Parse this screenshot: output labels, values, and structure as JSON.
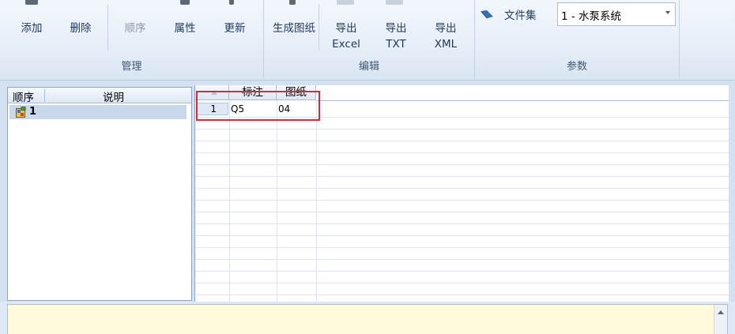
{
  "ribbon": {
    "groups": {
      "manage": "管理",
      "edit": "编辑",
      "params": "参数"
    },
    "buttons": {
      "add": "添加",
      "delete": "删除",
      "order": "顺序",
      "properties": "属性",
      "update": "更新",
      "generate": "生成图纸",
      "export_excel_1": "导出",
      "export_excel_2": "Excel",
      "export_txt_1": "导出",
      "export_txt_2": "TXT",
      "export_xml_1": "导出",
      "export_xml_2": "XML"
    },
    "fileset_label": "文件集",
    "fileset_value": "1 - 水泵系统"
  },
  "left_panel": {
    "headers": [
      "顺序",
      "说明"
    ],
    "rows": [
      {
        "order": "1",
        "desc": ""
      }
    ]
  },
  "grid": {
    "headers": [
      "标注",
      "图纸"
    ],
    "rows": [
      {
        "num": "1",
        "label": "Q5",
        "drawing": "04"
      }
    ]
  },
  "colors": {
    "highlight": "#e0262e",
    "notes_background": "#fefbdc"
  }
}
